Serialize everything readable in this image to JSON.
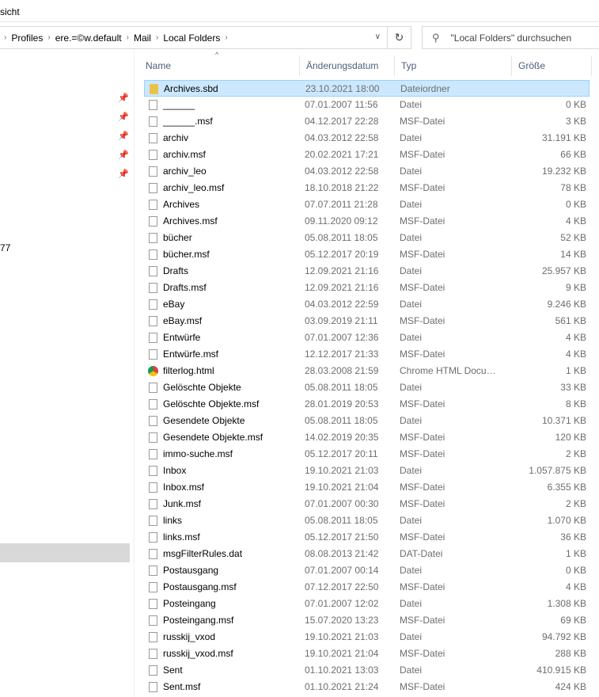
{
  "ribbon": {
    "label": "sicht"
  },
  "breadcrumb": [
    "Profiles",
    "ere.=©w.default",
    "Mail",
    "Local Folders"
  ],
  "search": {
    "placeholder": "\"Local Folders\" durchsuchen"
  },
  "nav": {
    "partial_text": "77"
  },
  "columns": {
    "name": "Name",
    "date": "Änderungsdatum",
    "type": "Typ",
    "size": "Größe"
  },
  "files": [
    {
      "name": "Archives.sbd",
      "date": "23.10.2021 18:00",
      "type": "Dateiordner",
      "size": "",
      "icon": "folder"
    },
    {
      "name": "______",
      "date": "07.01.2007 11:56",
      "type": "Datei",
      "size": "0 KB",
      "icon": "file"
    },
    {
      "name": "______.msf",
      "date": "04.12.2017 22:28",
      "type": "MSF-Datei",
      "size": "3 KB",
      "icon": "file"
    },
    {
      "name": "archiv",
      "date": "04.03.2012 22:58",
      "type": "Datei",
      "size": "31.191 KB",
      "icon": "file"
    },
    {
      "name": "archiv.msf",
      "date": "20.02.2021 17:21",
      "type": "MSF-Datei",
      "size": "66 KB",
      "icon": "file"
    },
    {
      "name": "archiv_leo",
      "date": "04.03.2012 22:58",
      "type": "Datei",
      "size": "19.232 KB",
      "icon": "file"
    },
    {
      "name": "archiv_leo.msf",
      "date": "18.10.2018 21:22",
      "type": "MSF-Datei",
      "size": "78 KB",
      "icon": "file"
    },
    {
      "name": "Archives",
      "date": "07.07.2011 21:28",
      "type": "Datei",
      "size": "0 KB",
      "icon": "file"
    },
    {
      "name": "Archives.msf",
      "date": "09.11.2020 09:12",
      "type": "MSF-Datei",
      "size": "4 KB",
      "icon": "file"
    },
    {
      "name": "bücher",
      "date": "05.08.2011 18:05",
      "type": "Datei",
      "size": "52 KB",
      "icon": "file"
    },
    {
      "name": "bücher.msf",
      "date": "05.12.2017 20:19",
      "type": "MSF-Datei",
      "size": "14 KB",
      "icon": "file"
    },
    {
      "name": "Drafts",
      "date": "12.09.2021 21:16",
      "type": "Datei",
      "size": "25.957 KB",
      "icon": "file"
    },
    {
      "name": "Drafts.msf",
      "date": "12.09.2021 21:16",
      "type": "MSF-Datei",
      "size": "9 KB",
      "icon": "file"
    },
    {
      "name": "eBay",
      "date": "04.03.2012 22:59",
      "type": "Datei",
      "size": "9.246 KB",
      "icon": "file"
    },
    {
      "name": "eBay.msf",
      "date": "03.09.2019 21:11",
      "type": "MSF-Datei",
      "size": "561 KB",
      "icon": "file"
    },
    {
      "name": "Entwürfe",
      "date": "07.01.2007 12:36",
      "type": "Datei",
      "size": "4 KB",
      "icon": "file"
    },
    {
      "name": "Entwürfe.msf",
      "date": "12.12.2017 21:33",
      "type": "MSF-Datei",
      "size": "4 KB",
      "icon": "file"
    },
    {
      "name": "filterlog.html",
      "date": "28.03.2008 21:59",
      "type": "Chrome HTML Document",
      "size": "1 KB",
      "icon": "chrome"
    },
    {
      "name": "Gelöschte Objekte",
      "date": "05.08.2011 18:05",
      "type": "Datei",
      "size": "33 KB",
      "icon": "file"
    },
    {
      "name": "Gelöschte Objekte.msf",
      "date": "28.01.2019 20:53",
      "type": "MSF-Datei",
      "size": "8 KB",
      "icon": "file"
    },
    {
      "name": "Gesendete Objekte",
      "date": "05.08.2011 18:05",
      "type": "Datei",
      "size": "10.371 KB",
      "icon": "file"
    },
    {
      "name": "Gesendete Objekte.msf",
      "date": "14.02.2019 20:35",
      "type": "MSF-Datei",
      "size": "120 KB",
      "icon": "file"
    },
    {
      "name": "immo-suche.msf",
      "date": "05.12.2017 20:11",
      "type": "MSF-Datei",
      "size": "2 KB",
      "icon": "file"
    },
    {
      "name": "Inbox",
      "date": "19.10.2021 21:03",
      "type": "Datei",
      "size": "1.057.875 KB",
      "icon": "file"
    },
    {
      "name": "Inbox.msf",
      "date": "19.10.2021 21:04",
      "type": "MSF-Datei",
      "size": "6.355 KB",
      "icon": "file"
    },
    {
      "name": "Junk.msf",
      "date": "07.01.2007 00:30",
      "type": "MSF-Datei",
      "size": "2 KB",
      "icon": "file"
    },
    {
      "name": "links",
      "date": "05.08.2011 18:05",
      "type": "Datei",
      "size": "1.070 KB",
      "icon": "file"
    },
    {
      "name": "links.msf",
      "date": "05.12.2017 21:50",
      "type": "MSF-Datei",
      "size": "36 KB",
      "icon": "file"
    },
    {
      "name": "msgFilterRules.dat",
      "date": "08.08.2013 21:42",
      "type": "DAT-Datei",
      "size": "1 KB",
      "icon": "file"
    },
    {
      "name": "Postausgang",
      "date": "07.01.2007 00:14",
      "type": "Datei",
      "size": "0 KB",
      "icon": "file"
    },
    {
      "name": "Postausgang.msf",
      "date": "07.12.2017 22:50",
      "type": "MSF-Datei",
      "size": "4 KB",
      "icon": "file"
    },
    {
      "name": "Posteingang",
      "date": "07.01.2007 12:02",
      "type": "Datei",
      "size": "1.308 KB",
      "icon": "file"
    },
    {
      "name": "Posteingang.msf",
      "date": "15.07.2020 13:23",
      "type": "MSF-Datei",
      "size": "69 KB",
      "icon": "file"
    },
    {
      "name": "russkij_vxod",
      "date": "19.10.2021 21:03",
      "type": "Datei",
      "size": "94.792 KB",
      "icon": "file"
    },
    {
      "name": "russkij_vxod.msf",
      "date": "19.10.2021 21:04",
      "type": "MSF-Datei",
      "size": "288 KB",
      "icon": "file"
    },
    {
      "name": "Sent",
      "date": "01.10.2021 13:03",
      "type": "Datei",
      "size": "410.915 KB",
      "icon": "file"
    },
    {
      "name": "Sent.msf",
      "date": "01.10.2021 21:24",
      "type": "MSF-Datei",
      "size": "424 KB",
      "icon": "file"
    }
  ]
}
